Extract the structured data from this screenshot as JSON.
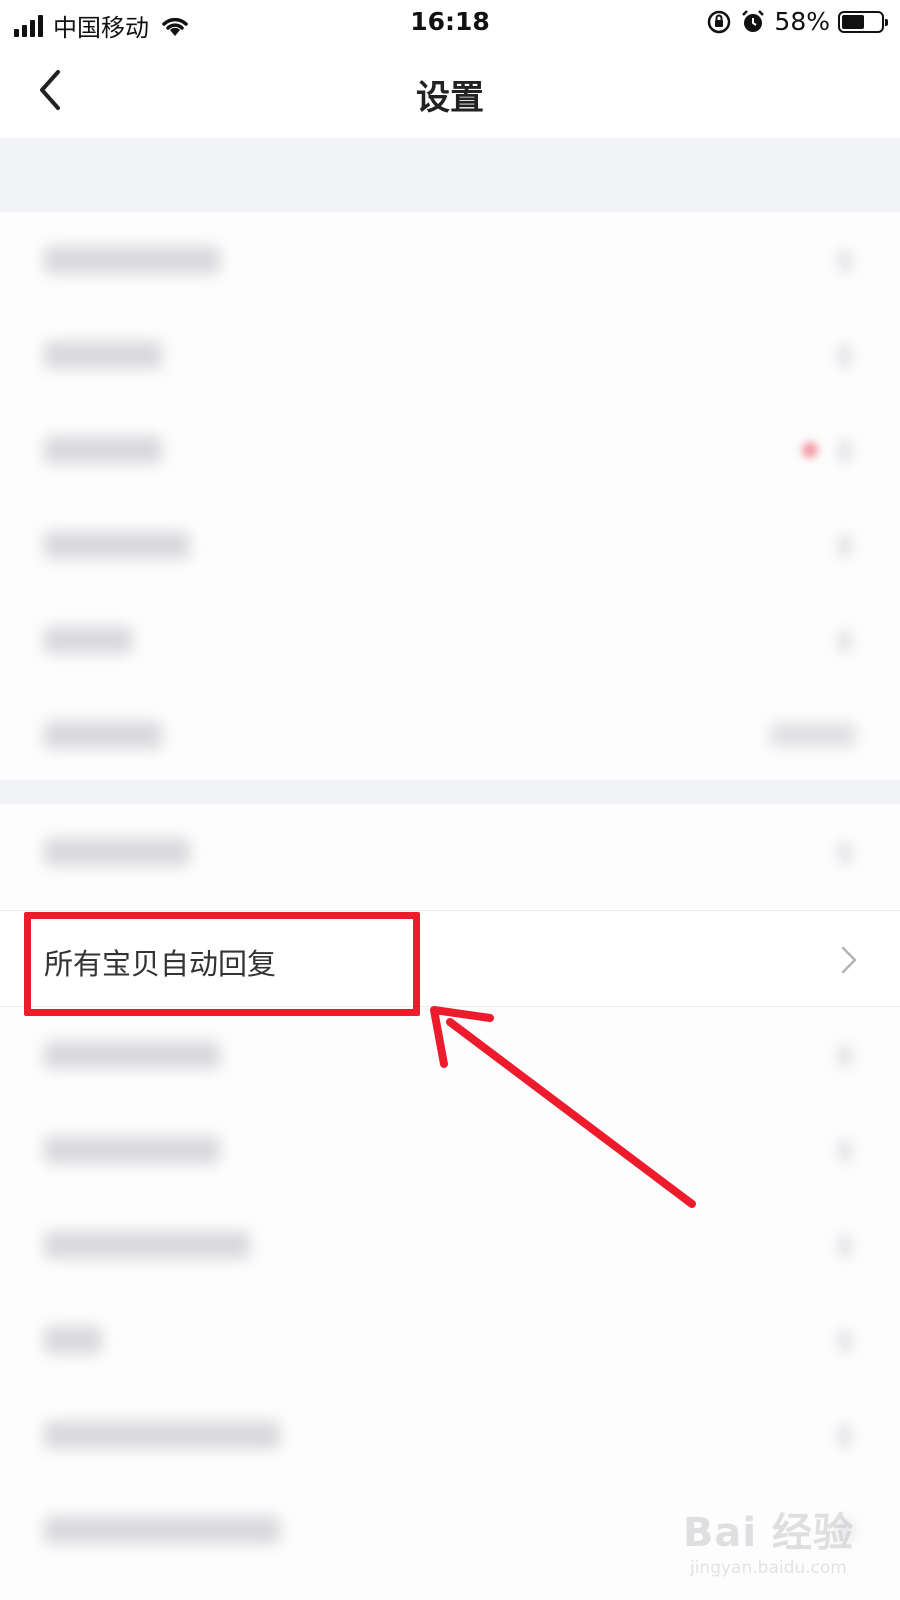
{
  "status_bar": {
    "carrier": "中国移动",
    "time": "16:18",
    "battery_percent": "58%",
    "battery_level": 0.58
  },
  "nav": {
    "title": "设置",
    "back_icon": "chevron-left-icon"
  },
  "highlighted_item": {
    "label": "所有宝贝自动回复",
    "chevron_icon": "chevron-right-icon"
  },
  "annotation": {
    "box_color": "#ee1b2c",
    "arrow_color": "#ee1b2c"
  },
  "watermark": {
    "brand": "Bai 经验",
    "url": "jingyan.baidu.com"
  }
}
